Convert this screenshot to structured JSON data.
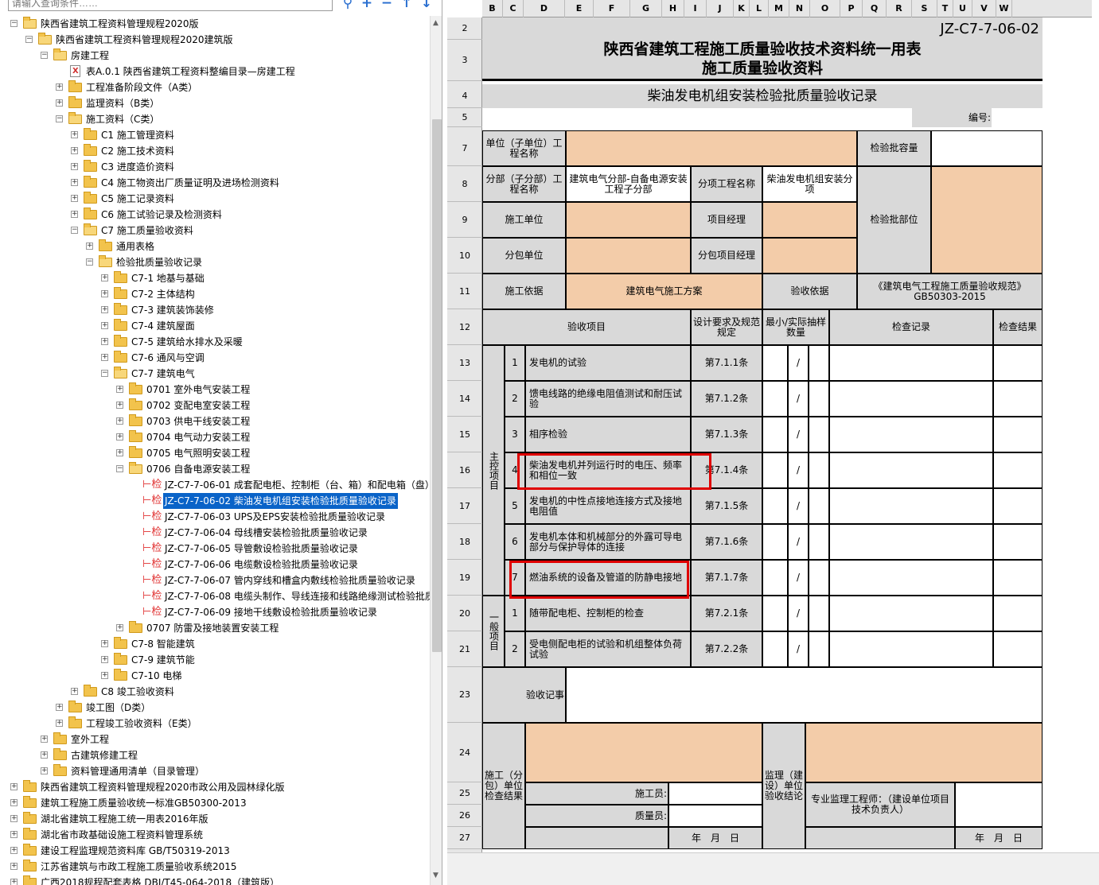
{
  "search": {
    "placeholder": "请输入查询条件……"
  },
  "toolbar_icons": [
    "search-icon",
    "plus-icon",
    "minus-icon",
    "up-arrow-icon",
    "down-arrow-icon"
  ],
  "tree": [
    {
      "level": 0,
      "toggle": "-",
      "icon": "folder-open",
      "label": "陕西省建筑工程资料管理规程2020版"
    },
    {
      "level": 1,
      "toggle": "-",
      "icon": "folder-open",
      "label": "陕西省建筑工程资料管理规程2020建筑版"
    },
    {
      "level": 2,
      "toggle": "-",
      "icon": "folder-open",
      "label": "房建工程"
    },
    {
      "level": 3,
      "toggle": "",
      "icon": "doc",
      "label": "表A.0.1 陕西省建筑工程资料整编目录—房建工程"
    },
    {
      "level": 3,
      "toggle": "+",
      "icon": "folder",
      "label": "工程准备阶段文件（A类）"
    },
    {
      "level": 3,
      "toggle": "+",
      "icon": "folder",
      "label": "监理资料（B类）"
    },
    {
      "level": 3,
      "toggle": "-",
      "icon": "folder-open",
      "label": "施工资料（C类）"
    },
    {
      "level": 4,
      "toggle": "+",
      "icon": "folder",
      "label": "C1 施工管理资料"
    },
    {
      "level": 4,
      "toggle": "+",
      "icon": "folder",
      "label": "C2 施工技术资料"
    },
    {
      "level": 4,
      "toggle": "+",
      "icon": "folder",
      "label": "C3 进度造价资料"
    },
    {
      "level": 4,
      "toggle": "+",
      "icon": "folder",
      "label": "C4 施工物资出厂质量证明及进场检测资料"
    },
    {
      "level": 4,
      "toggle": "+",
      "icon": "folder",
      "label": "C5 施工记录资料"
    },
    {
      "level": 4,
      "toggle": "+",
      "icon": "folder",
      "label": "C6 施工试验记录及检测资料"
    },
    {
      "level": 4,
      "toggle": "-",
      "icon": "folder-open",
      "label": "C7 施工质量验收资料"
    },
    {
      "level": 5,
      "toggle": "+",
      "icon": "folder",
      "label": "通用表格"
    },
    {
      "level": 5,
      "toggle": "-",
      "icon": "folder-open",
      "label": "检验批质量验收记录"
    },
    {
      "level": 6,
      "toggle": "+",
      "icon": "folder",
      "label": "C7-1 地基与基础"
    },
    {
      "level": 6,
      "toggle": "+",
      "icon": "folder",
      "label": "C7-2 主体结构"
    },
    {
      "level": 6,
      "toggle": "+",
      "icon": "folder",
      "label": "C7-3 建筑装饰装修"
    },
    {
      "level": 6,
      "toggle": "+",
      "icon": "folder",
      "label": "C7-4 建筑屋面"
    },
    {
      "level": 6,
      "toggle": "+",
      "icon": "folder",
      "label": "C7-5 建筑给水排水及采暖"
    },
    {
      "level": 6,
      "toggle": "+",
      "icon": "folder",
      "label": "C7-6 通风与空调"
    },
    {
      "level": 6,
      "toggle": "-",
      "icon": "folder-open",
      "label": "C7-7 建筑电气"
    },
    {
      "level": 7,
      "toggle": "+",
      "icon": "folder",
      "label": "0701 室外电气安装工程"
    },
    {
      "level": 7,
      "toggle": "+",
      "icon": "folder",
      "label": "0702 变配电室安装工程"
    },
    {
      "level": 7,
      "toggle": "+",
      "icon": "folder",
      "label": "0703 供电干线安装工程"
    },
    {
      "level": 7,
      "toggle": "+",
      "icon": "folder",
      "label": "0704 电气动力安装工程"
    },
    {
      "level": 7,
      "toggle": "+",
      "icon": "folder",
      "label": "0705 电气照明安装工程"
    },
    {
      "level": 7,
      "toggle": "-",
      "icon": "folder-open",
      "label": "0706 自备电源安装工程"
    },
    {
      "level": 8,
      "toggle": "",
      "icon": "jian",
      "label": "JZ-C7-7-06-01 成套配电柜、控制柜（台、箱）和配电箱（盘）安"
    },
    {
      "level": 8,
      "toggle": "",
      "icon": "jian",
      "label": "JZ-C7-7-06-02 柴油发电机组安装检验批质量验收记录",
      "selected": true
    },
    {
      "level": 8,
      "toggle": "",
      "icon": "jian",
      "label": "JZ-C7-7-06-03 UPS及EPS安装检验批质量验收记录"
    },
    {
      "level": 8,
      "toggle": "",
      "icon": "jian",
      "label": "JZ-C7-7-06-04 母线槽安装检验批质量验收记录"
    },
    {
      "level": 8,
      "toggle": "",
      "icon": "jian",
      "label": "JZ-C7-7-06-05 导管敷设检验批质量验收记录"
    },
    {
      "level": 8,
      "toggle": "",
      "icon": "jian",
      "label": "JZ-C7-7-06-06 电缆敷设检验批质量验收记录"
    },
    {
      "level": 8,
      "toggle": "",
      "icon": "jian",
      "label": "JZ-C7-7-06-07 管内穿线和槽盒内敷线检验批质量验收记录"
    },
    {
      "level": 8,
      "toggle": "",
      "icon": "jian",
      "label": "JZ-C7-7-06-08 电缆头制作、导线连接和线路绝缘测试检验批质量"
    },
    {
      "level": 8,
      "toggle": "",
      "icon": "jian",
      "label": "JZ-C7-7-06-09 接地干线敷设检验批质量验收记录"
    },
    {
      "level": 7,
      "toggle": "+",
      "icon": "folder",
      "label": "0707 防雷及接地装置安装工程"
    },
    {
      "level": 6,
      "toggle": "+",
      "icon": "folder",
      "label": "C7-8 智能建筑"
    },
    {
      "level": 6,
      "toggle": "+",
      "icon": "folder",
      "label": "C7-9 建筑节能"
    },
    {
      "level": 6,
      "toggle": "+",
      "icon": "folder",
      "label": "C7-10 电梯"
    },
    {
      "level": 4,
      "toggle": "+",
      "icon": "folder",
      "label": "C8 竣工验收资料"
    },
    {
      "level": 3,
      "toggle": "+",
      "icon": "folder",
      "label": "竣工图（D类）"
    },
    {
      "level": 3,
      "toggle": "+",
      "icon": "folder",
      "label": "工程竣工验收资料（E类）"
    },
    {
      "level": 2,
      "toggle": "+",
      "icon": "folder",
      "label": "室外工程"
    },
    {
      "level": 2,
      "toggle": "+",
      "icon": "folder",
      "label": "古建筑修建工程"
    },
    {
      "level": 2,
      "toggle": "+",
      "icon": "folder",
      "label": "资料管理通用清单（目录管理）"
    },
    {
      "level": 0,
      "toggle": "+",
      "icon": "folder",
      "label": "陕西省建筑工程资料管理规程2020市政公用及园林绿化版"
    },
    {
      "level": 0,
      "toggle": "+",
      "icon": "folder",
      "label": "建筑工程施工质量验收统一标准GB50300-2013"
    },
    {
      "level": 0,
      "toggle": "+",
      "icon": "folder",
      "label": "湖北省建筑工程施工统一用表2016年版"
    },
    {
      "level": 0,
      "toggle": "+",
      "icon": "folder",
      "label": "湖北省市政基础设施工程资料管理系统"
    },
    {
      "level": 0,
      "toggle": "+",
      "icon": "folder",
      "label": "建设工程监理规范资料库 GB/T50319-2013"
    },
    {
      "level": 0,
      "toggle": "+",
      "icon": "folder",
      "label": "江苏省建筑与市政工程施工质量验收系统2015"
    },
    {
      "level": 0,
      "toggle": "+",
      "icon": "folder",
      "label": "广西2018规程配套表格 DBJ/T45-064-2018（建筑版）"
    }
  ],
  "col_headers": [
    "B",
    "C",
    "D",
    "E",
    "F",
    "G",
    "H",
    "I",
    "J",
    "K",
    "L",
    "M",
    "N",
    "O",
    "P",
    "Q",
    "R",
    "S",
    "T",
    "U",
    "V",
    "W"
  ],
  "row_numbers": [
    "2",
    "3",
    "4",
    "5",
    "7",
    "8",
    "9",
    "10",
    "11",
    "12",
    "13",
    "14",
    "15",
    "16",
    "17",
    "18",
    "19",
    "20",
    "21",
    "23",
    "24",
    "25",
    "26",
    "27"
  ],
  "form": {
    "code": "JZ-C7-7-06-02",
    "title1": "陕西省建筑工程施工质量验收技术资料统一用表",
    "title2": "施工质量验收资料",
    "subtitle": "柴油发电机组安装检验批质量验收记录",
    "number_label": "编号:",
    "unit_label": "单位（子单位）工程名称",
    "capacity_label": "检验批容量",
    "division_label": "分部（子分部）工程名称",
    "division_value": "建筑电气分部-自备电源安装工程子分部",
    "subitem_label": "分项工程名称",
    "subitem_value": "柴油发电机组安装分项",
    "part_label": "检验批部位",
    "constructor_label": "施工单位",
    "pm_label": "项目经理",
    "sub_label": "分包单位",
    "sub_pm_label": "分包项目经理",
    "basis_label": "施工依据",
    "basis_value": "建筑电气施工方案",
    "accept_basis_label": "验收依据",
    "accept_basis_value": "《建筑电气工程施工质量验收规范》GB50303-2015",
    "h_item": "验收项目",
    "h_design": "设计要求及规范规定",
    "h_sample": "最小/实际抽样数量",
    "h_record": "检查记录",
    "h_result": "检查结果",
    "main_group": "主控项目",
    "general_group": "一般项目",
    "main_items": [
      {
        "n": "1",
        "text": "发电机的试验",
        "clause": "第7.1.1条",
        "slash": "/"
      },
      {
        "n": "2",
        "text": "馈电线路的绝缘电阻值测试和耐压试验",
        "clause": "第7.1.2条",
        "slash": "/"
      },
      {
        "n": "3",
        "text": "相序检验",
        "clause": "第7.1.3条",
        "slash": "/"
      },
      {
        "n": "4",
        "text": "柴油发电机并列运行时的电压、频率和相位一致",
        "clause": "第7.1.4条",
        "slash": "/"
      },
      {
        "n": "5",
        "text": "发电机的中性点接地连接方式及接地电阻值",
        "clause": "第7.1.5条",
        "slash": "/"
      },
      {
        "n": "6",
        "text": "发电机本体和机械部分的外露可导电部分与保护导体的连接",
        "clause": "第7.1.6条",
        "slash": "/"
      },
      {
        "n": "7",
        "text": "燃油系统的设备及管道的防静电接地",
        "clause": "第7.1.7条",
        "slash": "/"
      }
    ],
    "general_items": [
      {
        "n": "1",
        "text": "随带配电柜、控制柜的检查",
        "clause": "第7.2.1条",
        "slash": "/"
      },
      {
        "n": "2",
        "text": "受电侧配电柜的试验和机组整体负荷试验",
        "clause": "第7.2.2条",
        "slash": "/"
      }
    ],
    "notes_label": "验收记事",
    "constructor_conclusion": "施工（分包）单位检查结果",
    "worker_label": "施工员:",
    "qc_label": "质量员:",
    "date_label": "年　月　日",
    "supervisor_conclusion": "监理（建设）单位验收结论",
    "supervisor_label": "专业监理工程师：（建设单位项目技术负责人）",
    "date_label2": "年　月　日"
  },
  "colors": {
    "orange": "#f3cca9",
    "gray": "#d9d9d9",
    "selection": "#0a63c8",
    "highlight": "#e00000"
  }
}
